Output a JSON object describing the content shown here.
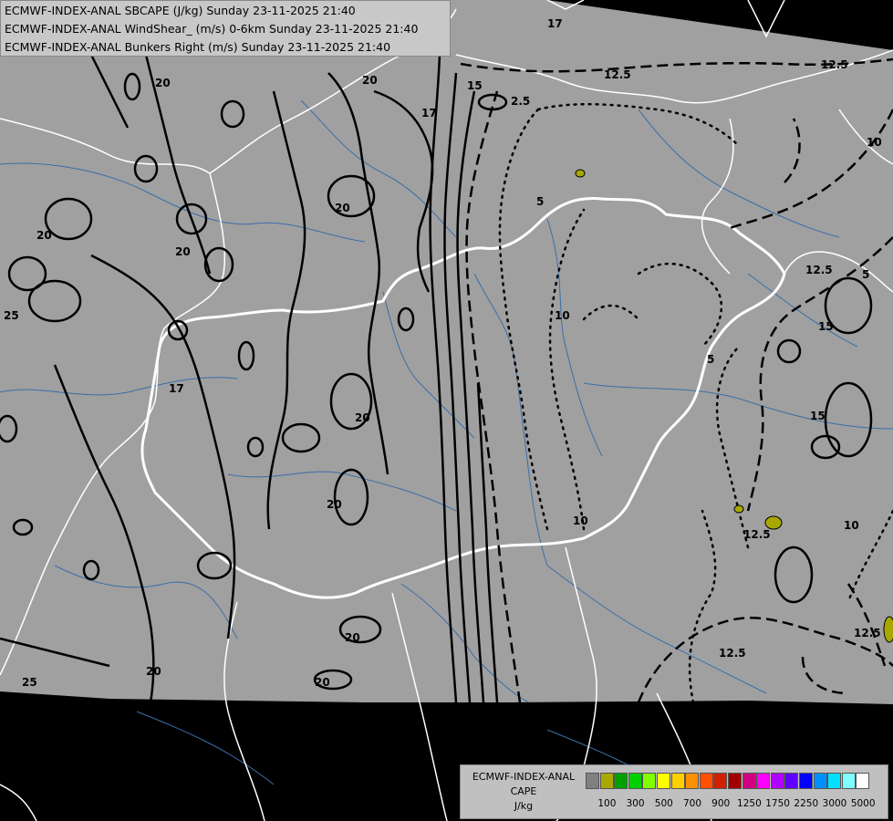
{
  "titles": [
    "ECMWF-INDEX-ANAL SBCAPE (J/kg) Sunday 23-11-2025 21:40",
    "ECMWF-INDEX-ANAL WindShear_ (m/s) 0-6km Sunday 23-11-2025 21:40",
    "ECMWF-INDEX-ANAL Bunkers Right (m/s) Sunday 23-11-2025 21:40"
  ],
  "legend": {
    "line1": "ECMWF-INDEX-ANAL",
    "line2": "CAPE",
    "line3": "J/kg",
    "colors": [
      "#808080",
      "#a8a800",
      "#00a000",
      "#00d000",
      "#80ff00",
      "#ffff00",
      "#ffd000",
      "#ff9000",
      "#ff5000",
      "#d02000",
      "#a00000",
      "#d00080",
      "#ff00ff",
      "#b000ff",
      "#6000ff",
      "#0000ff",
      "#0090ff",
      "#00e0ff",
      "#80ffff",
      "#ffffff"
    ],
    "ticks": [
      "100",
      "300",
      "500",
      "700",
      "900",
      "1250",
      "1750",
      "2250",
      "3000",
      "5000"
    ]
  },
  "colors": {
    "field": "#a0a0a0",
    "outside": "#000000",
    "borders": "#ffffff",
    "rivers": "#3a6ea8",
    "cape_low": "#a8a800"
  },
  "contour_labels": [
    "20",
    "20",
    "20",
    "20",
    "20",
    "20",
    "20",
    "20",
    "20",
    "20",
    "17",
    "17",
    "17",
    "25",
    "25",
    "15",
    "12.5",
    "12.5",
    "12.5",
    "12.5",
    "12.5",
    "12.5",
    "10",
    "10",
    "10",
    "10",
    "5",
    "5",
    "5",
    "15",
    "15",
    "2.5"
  ]
}
